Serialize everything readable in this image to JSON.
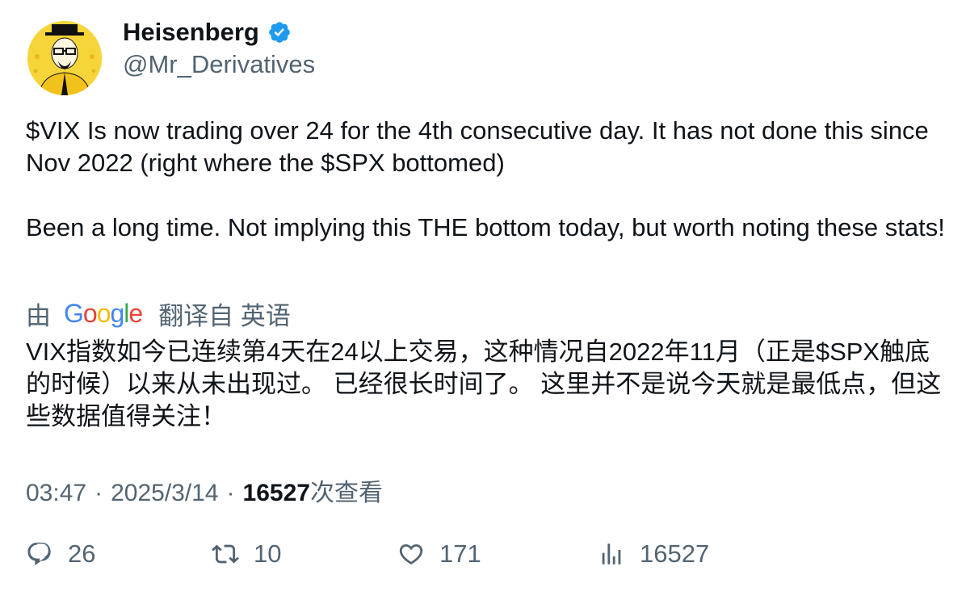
{
  "author": {
    "display_name": "Heisenberg",
    "handle": "@Mr_Derivatives",
    "verified_icon": "verified-badge-icon",
    "badge_color": "#1d9bf0"
  },
  "tweet": {
    "paragraphs": [
      "$VIX Is now trading over 24 for the 4th consecutive day. It has not done this since Nov 2022 (right where the $SPX bottomed)",
      "Been a long time. Not implying this THE bottom today, but worth noting these stats!"
    ]
  },
  "translation": {
    "by_label": "由",
    "google_letters": [
      "G",
      "o",
      "o",
      "g",
      "l",
      "e"
    ],
    "google_colors": [
      "#4285f4",
      "#ea4335",
      "#fbbc05",
      "#4285f4",
      "#34a853",
      "#ea4335"
    ],
    "translated_from_label": "翻译自 英语",
    "text": "VIX指数如今已连续第4天在24以上交易，这种情况自2022年11月（正是$SPX触底的时候）以来从未出现过。 已经很长时间了。 这里并不是说今天就是最低点，但这些数据值得关注！"
  },
  "meta": {
    "time": "03:47",
    "separator": "·",
    "date": "2025/3/14",
    "views_count": "16527",
    "views_label": "次查看"
  },
  "actions": {
    "replies": {
      "icon": "reply-icon",
      "count": "26"
    },
    "retweets": {
      "icon": "retweet-icon",
      "count": "10"
    },
    "likes": {
      "icon": "heart-icon",
      "count": "171"
    },
    "views": {
      "icon": "analytics-icon",
      "count": "16527"
    }
  },
  "colors": {
    "text_primary": "#0f1419",
    "text_secondary": "#536471",
    "avatar_background": "#f6d53a"
  }
}
